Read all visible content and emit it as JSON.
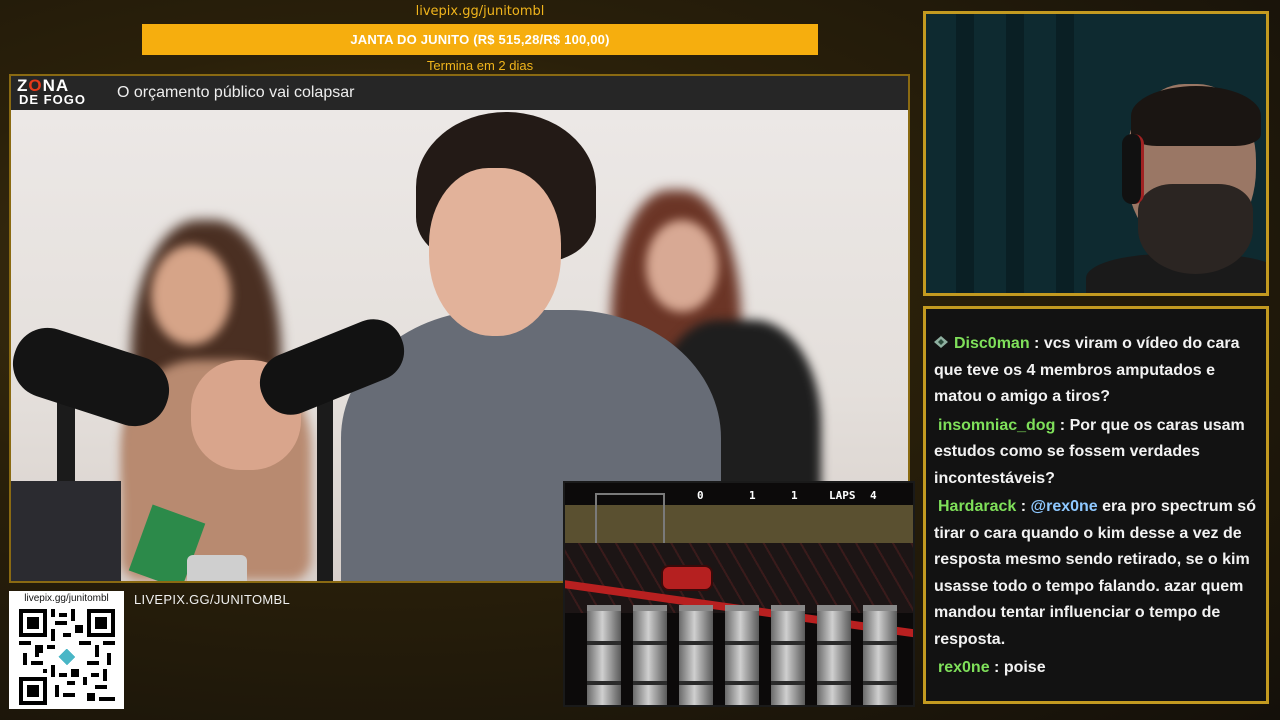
{
  "donation": {
    "url": "livepix.gg/junitombl",
    "goal_text": "JANTA DO JUNITO (R$ 515,28/R$ 100,00)",
    "ends_text": "Termina em 2 dias",
    "bar_color": "#f6ae0e"
  },
  "video": {
    "logo_line1_a": "Z",
    "logo_line1_b": "O",
    "logo_line1_c": "NA",
    "logo_line2": "DE FOGO",
    "title": "O orçamento público vai colapsar"
  },
  "qr": {
    "url": "livepix.gg/junitombl",
    "label": "LIVEPIX.GG/JUNITOMBL"
  },
  "game_hud": {
    "count1": "0",
    "count2": "1",
    "count3": "1",
    "laps_label": "LAPS",
    "laps_value": "4"
  },
  "chat": {
    "messages": [
      {
        "user": "Disc0man",
        "user_color": "#7fe05a",
        "sep": " : ",
        "text": "vcs viram o vídeo do cara que teve os 4 membros amputados e matou o amigo a tiros?",
        "badge": "chat-badge-icon"
      },
      {
        "user": "insomniac_dog",
        "user_color": "#7fe05a",
        "sep": " : ",
        "text": "Por que os caras usam estudos como se fossem verdades incontestáveis?"
      },
      {
        "user": "Hardarack",
        "user_color": "#7fe05a",
        "sep": " : ",
        "mention": "@rex0ne",
        "text": " era pro spectrum só tirar o cara quando o kim desse a vez de resposta mesmo sendo retirado, se o kim usasse todo o tempo falando. azar quem mandou tentar influenciar o tempo de resposta."
      },
      {
        "user": "rex0ne",
        "user_color": "#7fe05a",
        "sep": " : ",
        "text": "poise"
      }
    ]
  },
  "colors": {
    "frame_gold": "#c39a20",
    "accent_text": "#f1b51c",
    "username_green": "#7fe05a",
    "mention_blue": "#8ec8ff"
  }
}
